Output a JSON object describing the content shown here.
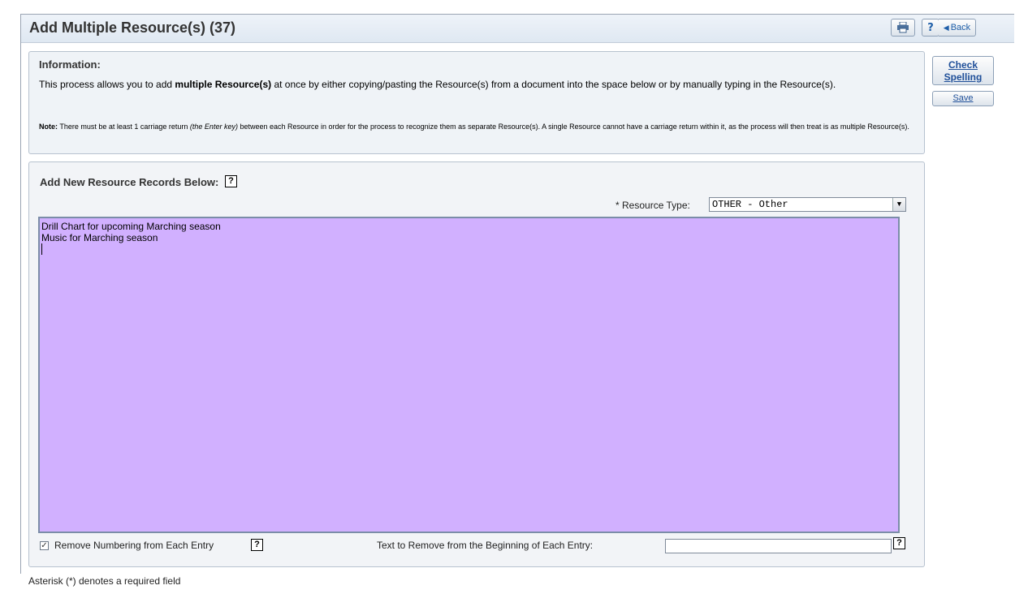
{
  "header": {
    "title": "Add Multiple Resource(s) (37)",
    "help_label": "?",
    "back_label": "Back"
  },
  "info": {
    "heading": "Information:",
    "text_prefix": "This process allows you to add ",
    "text_bold": "multiple Resource(s)",
    "text_suffix": " at once by either copying/pasting the Resource(s) from a document into the space below or by manually typing in the Resource(s).",
    "note_label": "Note:",
    "note_prefix": " There must be at least 1 carriage return ",
    "note_italic": "(the Enter key)",
    "note_suffix": " between each Resource in order for the process to recognize them as separate Resource(s). A single Resource cannot have a carriage return within it, as the process will then treat is as multiple Resource(s)."
  },
  "actions": {
    "check_spelling_line1": "Check",
    "check_spelling_line2": "Spelling",
    "save_label": "Save"
  },
  "records": {
    "heading": "Add New Resource Records Below:",
    "help_label": "?",
    "resource_type_label": "* Resource Type:",
    "resource_type_value": "OTHER - Other",
    "entries": [
      "Drill Chart for upcoming Marching season",
      "Music for Marching season"
    ],
    "remove_numbering_label": "Remove Numbering from Each Entry",
    "remove_numbering_checked": true,
    "strip_text_label": "Text to Remove from the Beginning of Each Entry:",
    "strip_text_value": ""
  },
  "footer": {
    "required_note": "Asterisk (*) denotes a required field"
  },
  "colors": {
    "entry_background": "#d1b0ff",
    "link_blue": "#1f4f99"
  },
  "icons": [
    "printer-icon",
    "help-icon",
    "back-arrow-icon",
    "checkbox-icon",
    "dropdown-arrow-icon"
  ]
}
